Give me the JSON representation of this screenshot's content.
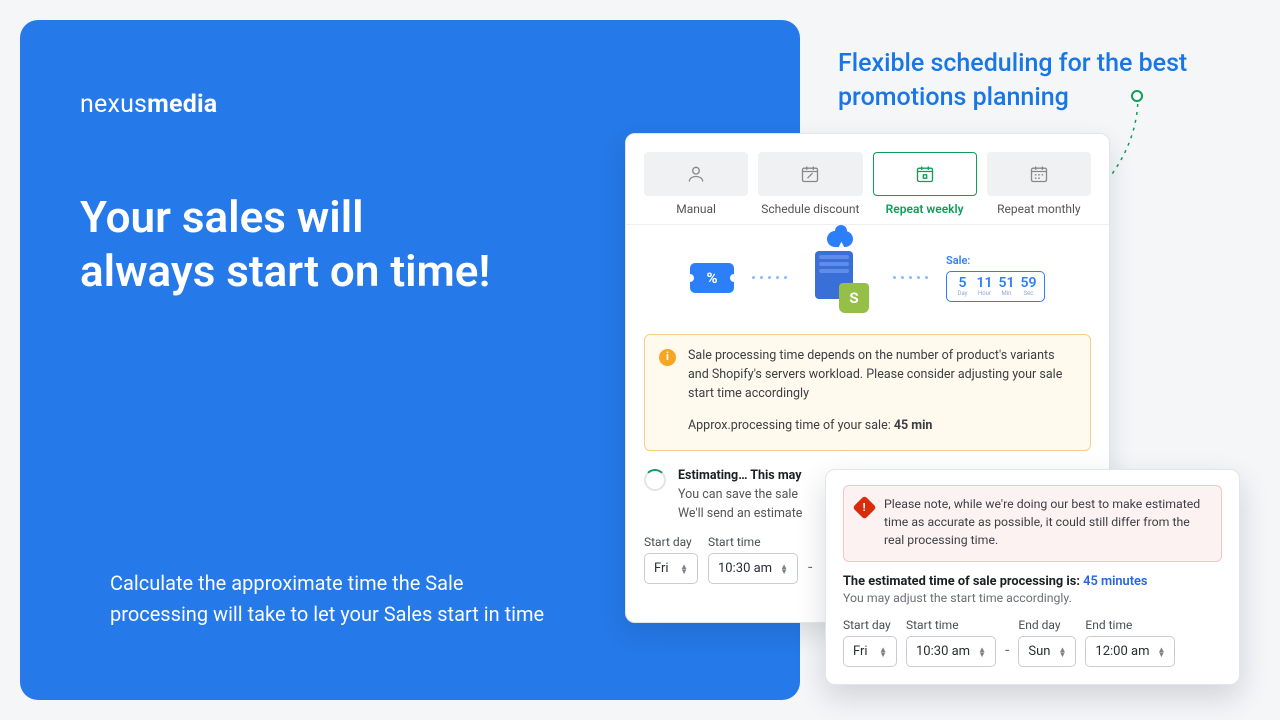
{
  "logo": {
    "light": "nexus",
    "bold": "media"
  },
  "headline": "Your sales will always start on time!",
  "sub": "Calculate the approximate time the Sale processing will take to let your Sales start in time",
  "promo_title": "Flexible scheduling for the best promotions planning",
  "tabs": [
    {
      "label": "Manual"
    },
    {
      "label": "Schedule discount"
    },
    {
      "label": "Repeat weekly"
    },
    {
      "label": "Repeat monthly"
    }
  ],
  "ticket_pct": "%",
  "sale_label": "Sale:",
  "timer": [
    {
      "n": "5",
      "u": "Day"
    },
    {
      "n": "11",
      "u": "Hour"
    },
    {
      "n": "51",
      "u": "Min"
    },
    {
      "n": "59",
      "u": "Sec"
    }
  ],
  "alert": {
    "text": "Sale processing time depends on the number of product's variants and Shopify's servers workload. Please consider adjusting your sale start time accordingly",
    "approx_prefix": "Approx.processing time of your sale: ",
    "approx_value": "45 min"
  },
  "estimating": {
    "title": "Estimating… This may",
    "line1": "You can save the sale",
    "line2": "We'll send an estimate"
  },
  "fields": {
    "start_day": "Start day",
    "start_time": "Start time",
    "end_day": "End day",
    "end_time": "End time",
    "fri": "Fri",
    "t1030": "10:30 am",
    "sun": "Sun",
    "t1200": "12:00 am"
  },
  "pop": {
    "warn": "Please note, while we're doing our best to make estimated time as accurate as possible, it could still differ from the real processing time.",
    "est_prefix": "The estimated time of sale processing is: ",
    "est_value": "45 minutes",
    "est_sub": "You may adjust the start time accordingly."
  }
}
